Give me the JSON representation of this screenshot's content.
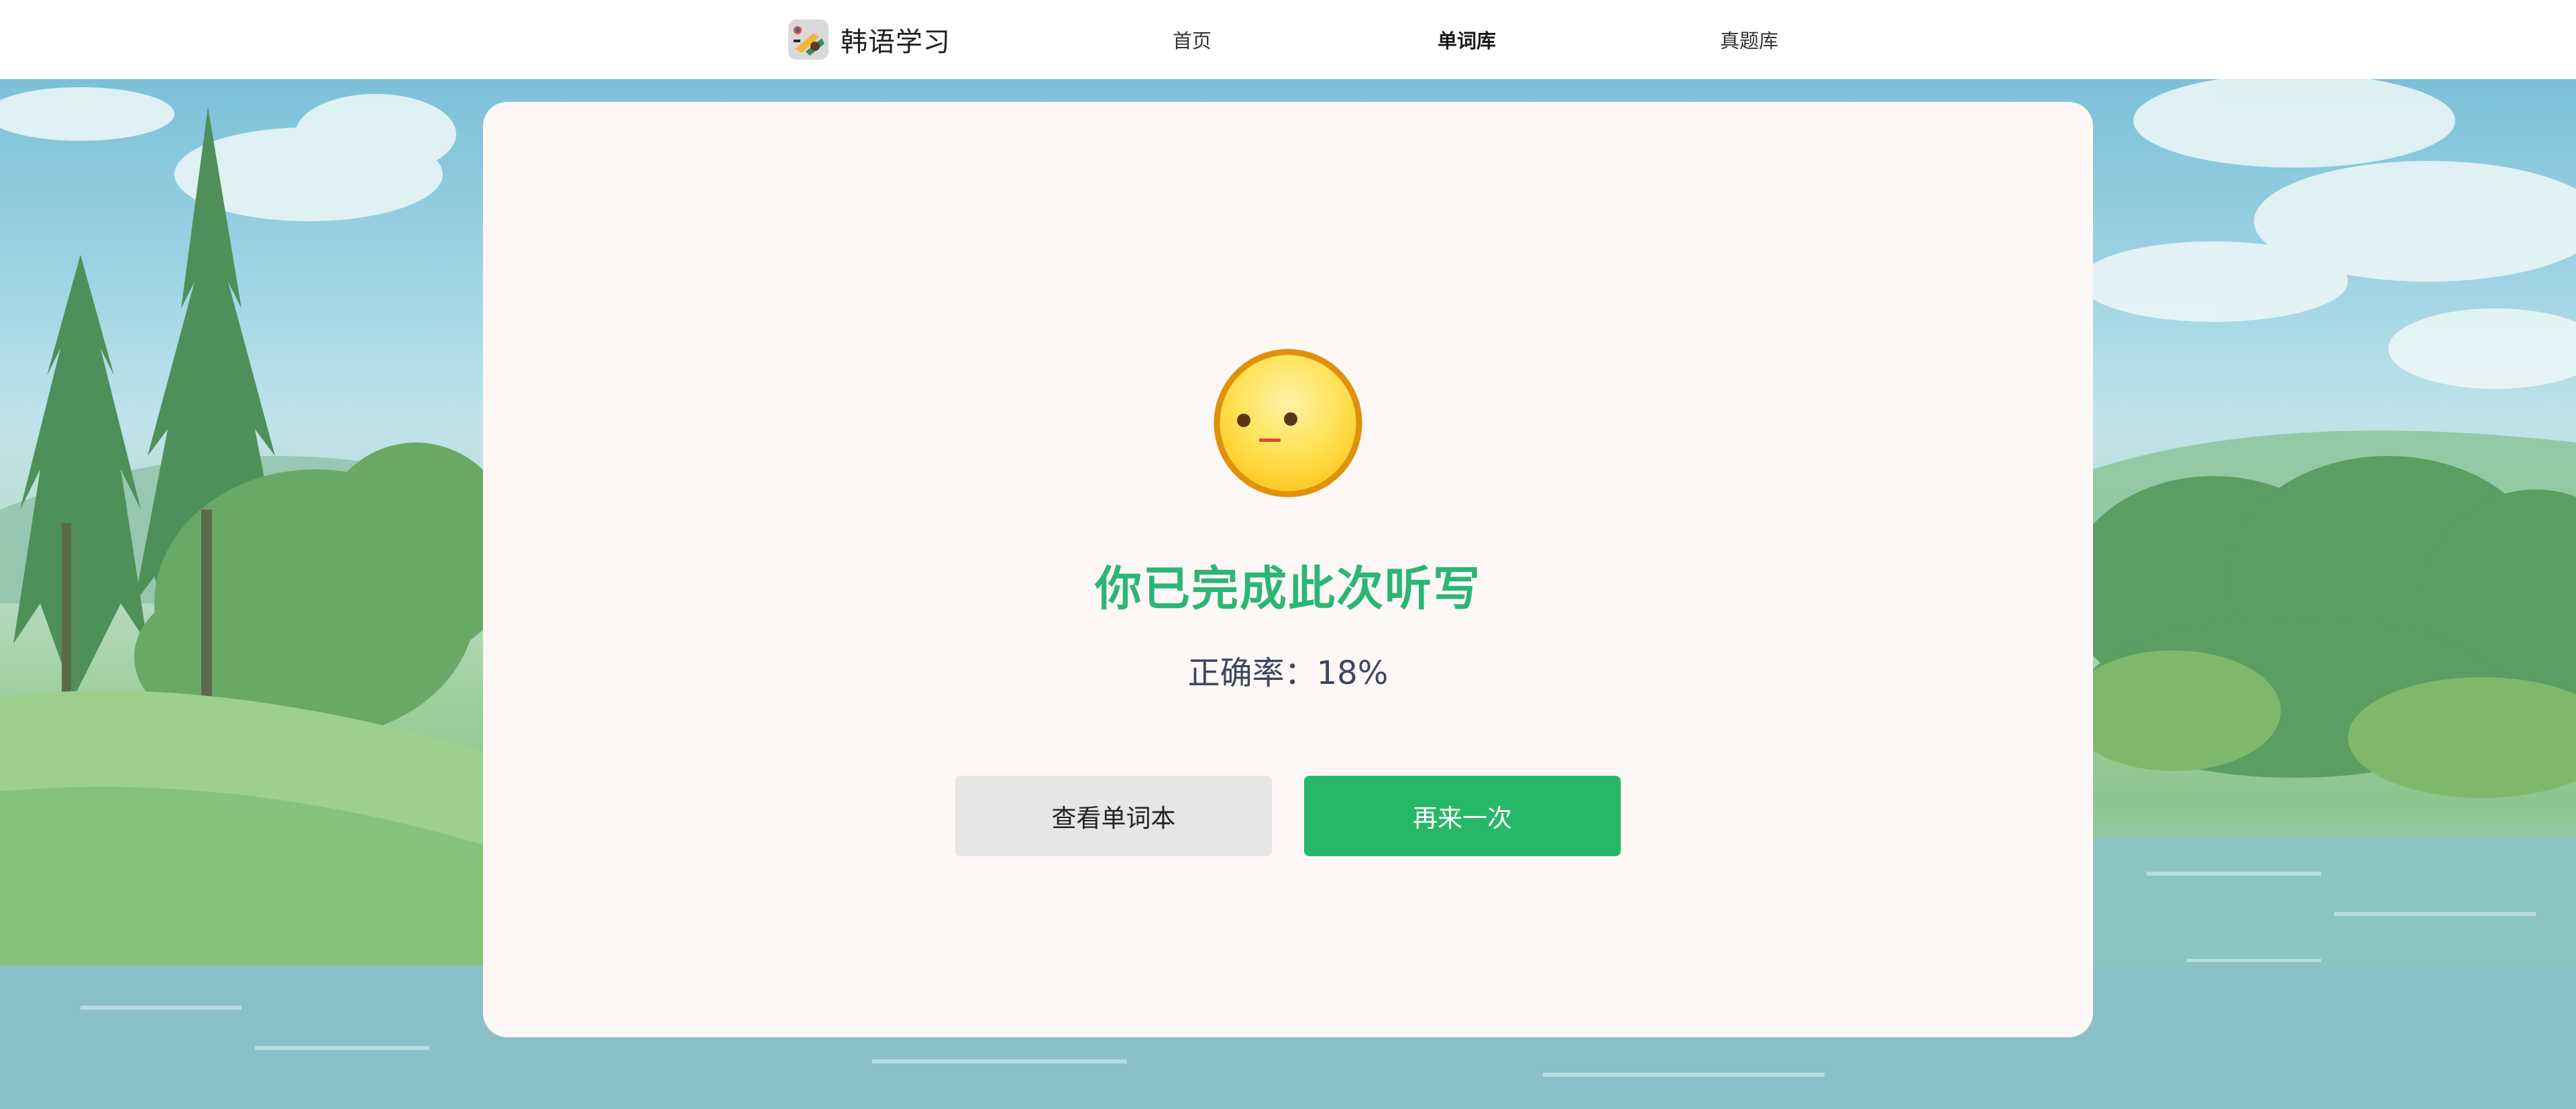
{
  "app": {
    "title": "韩语学习",
    "logo_icon": "korean-learning-logo-icon"
  },
  "nav": {
    "items": [
      {
        "label": "首页",
        "active": false
      },
      {
        "label": "单词库",
        "active": true
      },
      {
        "label": "真题库",
        "active": false
      }
    ]
  },
  "result": {
    "emoji_icon": "neutral-face-icon",
    "title": "你已完成此次听写",
    "accuracy_label": "正确率：18%",
    "accuracy_value": 18
  },
  "actions": {
    "view_wordbook_label": "查看单词本",
    "retry_label": "再来一次"
  },
  "colors": {
    "accent_green": "#26b866",
    "title_green": "#2bb673",
    "card_bg": "#fdf7f5",
    "secondary_button": "#e6e6e6"
  }
}
